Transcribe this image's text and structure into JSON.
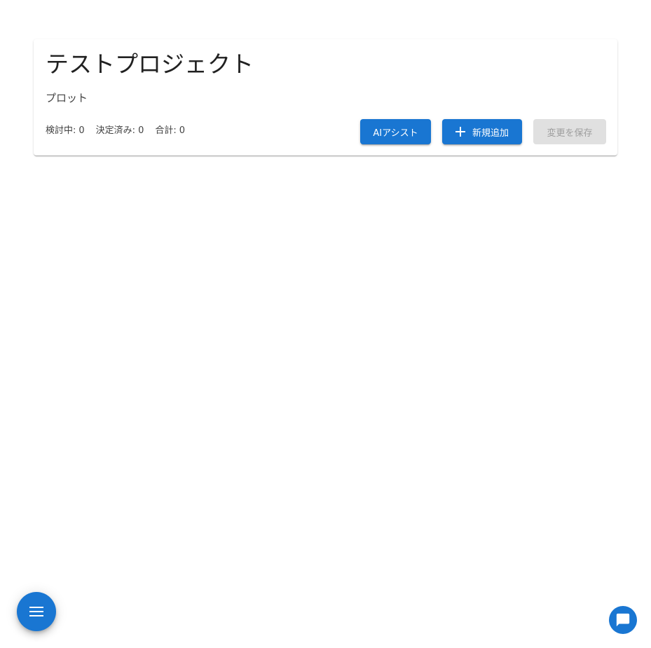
{
  "project": {
    "title": "テストプロジェクト",
    "section": "プロット"
  },
  "stats": [
    {
      "label": "検討中:",
      "value": "0"
    },
    {
      "label": "決定済み:",
      "value": "0"
    },
    {
      "label": "合計:",
      "value": "0"
    }
  ],
  "actions": {
    "ai_assist_label": "AIアシスト",
    "add_new_label": "新規追加",
    "save_label": "変更を保存"
  },
  "icons": {
    "add": "plus-icon",
    "menu": "menu-icon",
    "chat": "chat-icon"
  },
  "colors": {
    "primary": "#1976d2",
    "disabled_bg": "#e0e0e0",
    "disabled_text": "#9e9e9e"
  }
}
